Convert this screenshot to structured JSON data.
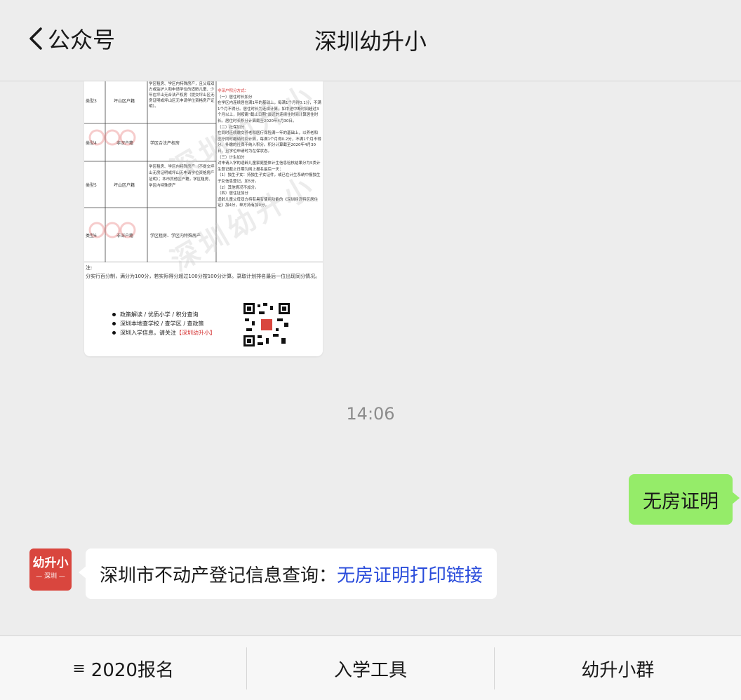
{
  "header": {
    "back_label": "公众号",
    "title": "深圳幼升小"
  },
  "poster": {
    "watermark": "深圳幼升小",
    "rows": [
      {
        "type": "类型3",
        "huji": "坪山区户籍",
        "desc": "学区租房、学区内特殊房产，且父母双方或监护人和申请学位的适龄儿童、少年在坪山无合法产权房（提交坪山区无房证明或坪山区无申请学位资格房产证明）。"
      },
      {
        "type": "类型4",
        "huji": "非深户籍",
        "desc": "学区合法产权房"
      },
      {
        "type": "类型5",
        "huji": "坪山区户籍",
        "desc": "学区租房、学区内特殊房产（不提交坪山无房证明或坪山无申请学位资格房产证明）；本市其他区户籍，学区租房、学区内特殊房产"
      },
      {
        "type": "类型6",
        "huji": "非深户籍",
        "desc": "学区租房、学区内特殊房产"
      }
    ],
    "points_title": "非深户积分方式：",
    "points_text": [
      "（一）居住时长加分",
      "在学区内连续居住满1年的基础上，每满1个月得0.1分，不满1个月不得分。居住时长为连续计算，如中途中断时间超过3个月以上，则按离“截止日期”最近的连续住时间计算居住时长。居住时长积分计算截至2020年4月30日。",
      "（二）社保加分",
      "在同时连续缴交养老和医疗保险满一年的基础上，以养老和医疗同时缴纳时间计算，每满1个月得0.2分，不满1个月不得分。补缴的社保不纳入积分。积分计算截至2020年4月30日，且学位申请时为在保状态。",
      "（三）计生加分",
      "对申请入学的适龄儿童家庭整体计生信息验核结果分为5类计生登记截止日期为网上报名最后一天：",
      "（1）独生子女：持独生子女证件，或已在计生系统中报独生子女信息登记，加5分。",
      "（2）其他情况不加分。",
      "（四）居住证加分",
      "适龄儿童父母双方持有具有使用功能的《深圳经济特区居住证》加4分，单方持有加0分。"
    ],
    "note_label": "注:",
    "note_text": "分实行百分制，满分为100分，若实际得分超过100分按100分计算。录取计划排名最后一位出现同分情况。",
    "promo_lines": [
      "政策解读 / 优质小学 / 积分查询",
      "深圳本地查学校 / 查学区 / 查政策",
      "深圳入学信息，请关注"
    ],
    "promo_red": "【深圳幼升小】"
  },
  "messages": {
    "timestamp": "14:06",
    "outgoing_text": "无房证明",
    "incoming_prefix": "深圳市不动产登记信息查询：",
    "incoming_link": "无房证明打印链接",
    "avatar_line1": "幼升小",
    "avatar_line2": "— 深圳 —"
  },
  "menu": {
    "items": [
      {
        "label": "2020报名",
        "icon": "≡"
      },
      {
        "label": "入学工具"
      },
      {
        "label": "幼升小群"
      }
    ]
  },
  "colors": {
    "bubble_out": "#95ec69",
    "link": "#2a4cdb",
    "avatar": "#d9463e"
  }
}
